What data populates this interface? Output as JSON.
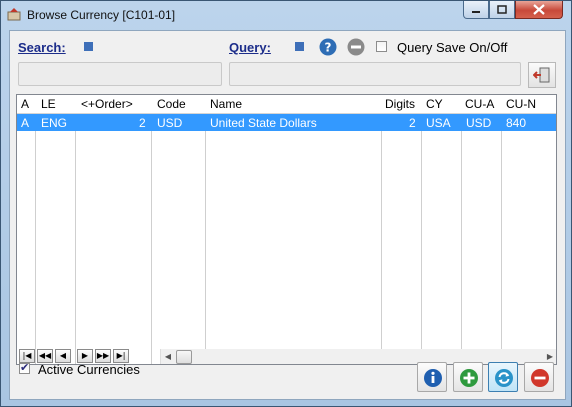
{
  "window": {
    "title": "Browse Currency [C101-01]"
  },
  "search": {
    "label": "Search:",
    "value": ""
  },
  "query": {
    "label": "Query:",
    "value": "",
    "save_label": "Query Save On/Off",
    "save_checked": false
  },
  "grid": {
    "columns": [
      "A",
      "LE",
      "<+Order>",
      "Code",
      "Name",
      "Digits",
      "CY",
      "CU-A",
      "CU-N"
    ],
    "rows": [
      {
        "a": "A",
        "le": "ENG",
        "order": "2",
        "code": "USD",
        "name": "United State Dollars",
        "digits": "2",
        "cy": "USA",
        "cua": "USD",
        "cun": "840"
      }
    ]
  },
  "footer": {
    "active_label": "Active Currencies",
    "active_checked": true
  },
  "icons": {
    "info": "info-icon",
    "add": "add-icon",
    "refresh": "refresh-icon",
    "delete": "delete-icon",
    "exit": "exit-door-icon",
    "help": "help-icon",
    "clear": "clear-icon"
  },
  "colors": {
    "selection": "#3399ff",
    "link": "#1c2d8a",
    "accent_blue": "#3e6fb8"
  }
}
